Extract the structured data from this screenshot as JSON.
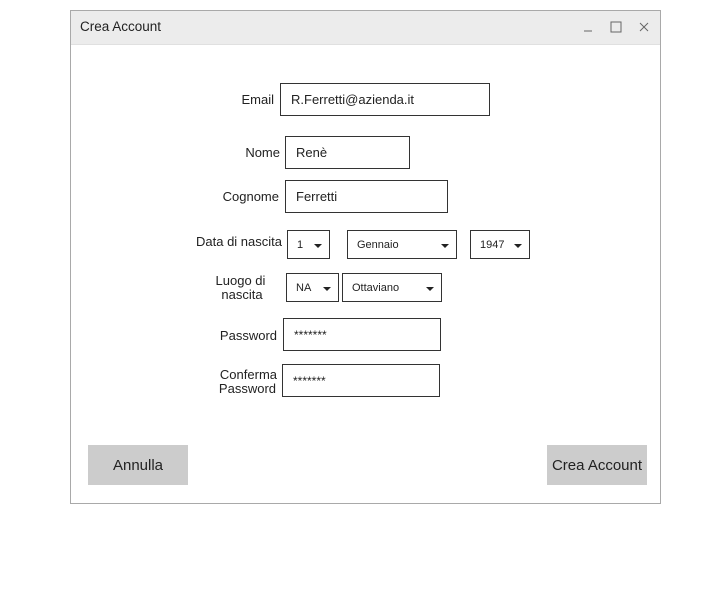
{
  "window": {
    "title": "Crea Account"
  },
  "form": {
    "email": {
      "label": "Email",
      "value": "R.Ferretti@azienda.it"
    },
    "nome": {
      "label": "Nome",
      "value": "Renè"
    },
    "cognome": {
      "label": "Cognome",
      "value": "Ferretti"
    },
    "nascita": {
      "label": "Data di nascita",
      "day": "1",
      "month": "Gennaio",
      "year": "1947"
    },
    "luogo": {
      "label_line1": "Luogo di",
      "label_line2": "nascita",
      "province": "NA",
      "city": "Ottaviano"
    },
    "password": {
      "label": "Password",
      "value": "*******"
    },
    "conferma": {
      "label_line1": "Conferma",
      "label_line2": "Password",
      "value": "*******"
    }
  },
  "buttons": {
    "cancel": "Annulla",
    "create": "Crea Account"
  },
  "icons": {
    "minimize": "minimize-icon",
    "maximize": "maximize-icon",
    "close": "close-icon",
    "dropdown": "chevron-down-icon"
  }
}
